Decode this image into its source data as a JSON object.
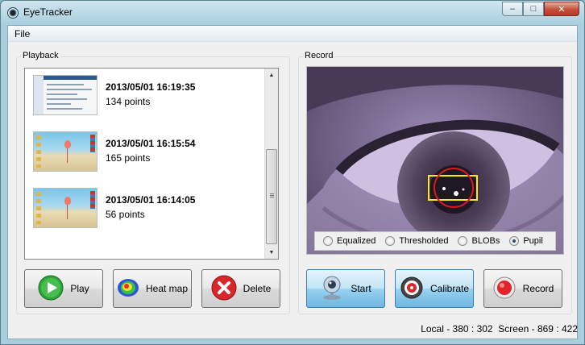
{
  "window": {
    "title": "EyeTracker",
    "min_glyph": "–",
    "max_glyph": "□",
    "close_glyph": "✕"
  },
  "menu": {
    "file": "File"
  },
  "playback": {
    "label": "Playback",
    "items": [
      {
        "date": "2013/05/01 16:19:35",
        "points": "134 points",
        "thumbnail": "desktop-screenshot"
      },
      {
        "date": "2013/05/01 16:15:54",
        "points": "165 points",
        "thumbnail": "beach-flamingo"
      },
      {
        "date": "2013/05/01 16:14:05",
        "points": "56 points",
        "thumbnail": "beach-flamingo"
      }
    ],
    "buttons": {
      "play": "Play",
      "heat_map": "Heat map",
      "delete": "Delete"
    }
  },
  "record": {
    "label": "Record",
    "view_modes": [
      {
        "label": "Equalized",
        "checked": false
      },
      {
        "label": "Thresholded",
        "checked": false
      },
      {
        "label": "BLOBs",
        "checked": false
      },
      {
        "label": "Pupil",
        "checked": true
      }
    ],
    "buttons": {
      "start": "Start",
      "calibrate": "Calibrate",
      "record": "Record"
    }
  },
  "status": {
    "text": "Local - 380 : 302  Screen - 869 : 422"
  },
  "colors": {
    "pupil_box": "#ffe81a",
    "pupil_circle": "#e01818",
    "play_green": "#2fa43a",
    "delete_red": "#d8262a",
    "record_red": "#e0242a",
    "button_blue": "#98d1ef"
  }
}
